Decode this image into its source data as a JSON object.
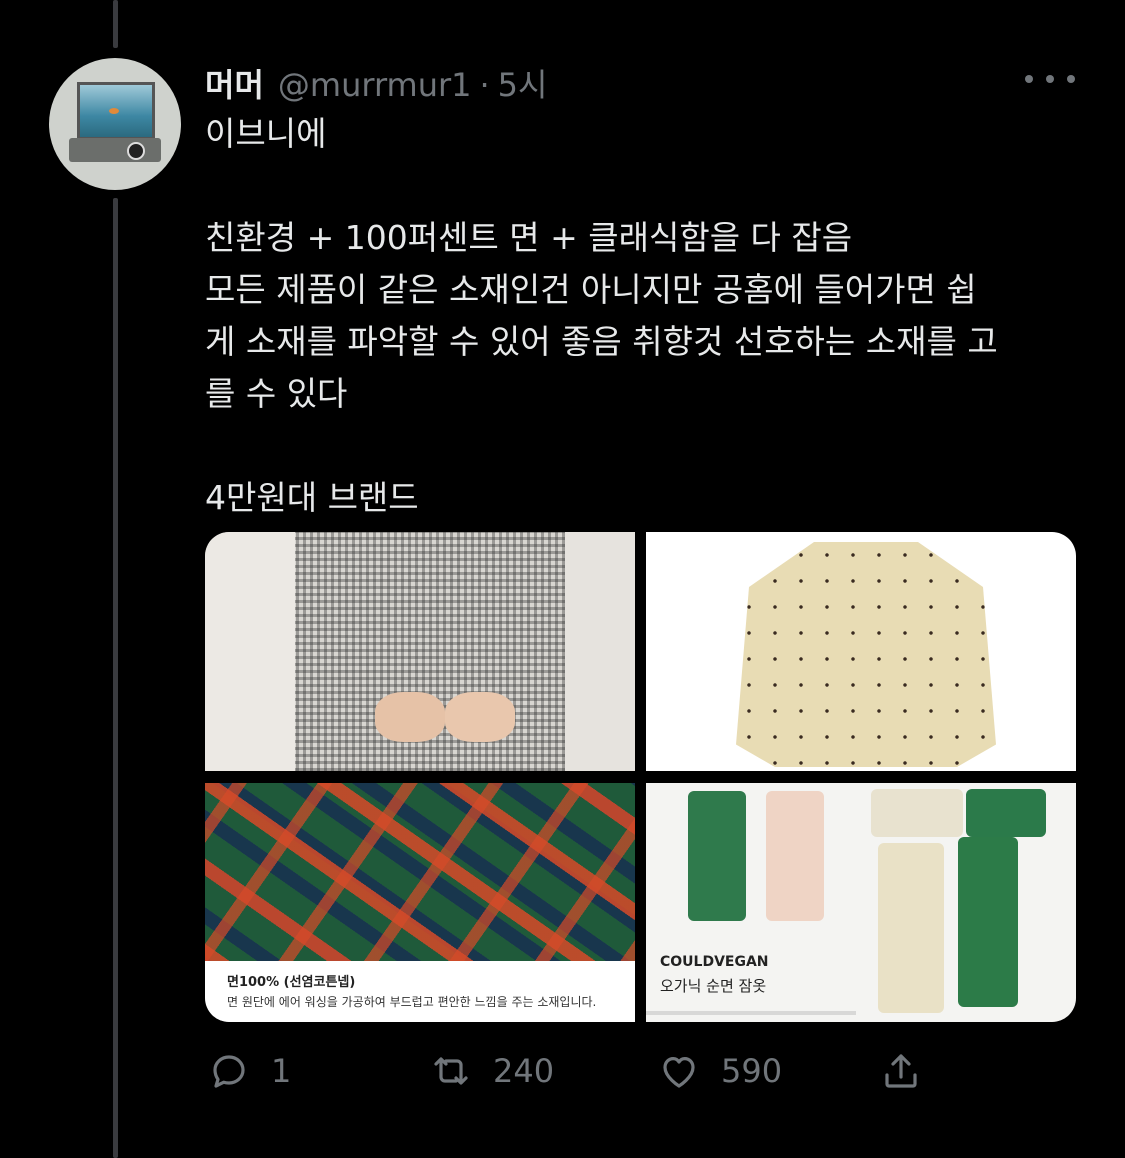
{
  "tweet": {
    "display_name": "머머",
    "handle": "@murrmur1",
    "separator": "·",
    "time": "5시",
    "lines": [
      "이브니에",
      "",
      "친환경 + 100퍼센트 면 + 클래식함을 다 잡음",
      "모든 제품이 같은 소재인건 아니지만 공홈에 들어가면 쉽",
      "게 소재를 파악할 수 있어 좋음 취향것 선호하는 소재를 고",
      "를 수 있다",
      "",
      "4만원대 브랜드"
    ]
  },
  "media": {
    "photo3_caption_title": "면100% (선염코튼넵)",
    "photo3_caption_text": "면 원단에 에어 워싱을 가공하여 부드럽고 편안한 느낌을 주는 소재입니다.",
    "photo4_brand": "COULDVEGAN",
    "photo4_subtitle": "오가닉 순면 잠옷"
  },
  "actions": {
    "reply_count": "1",
    "retweet_count": "240",
    "like_count": "590"
  },
  "icons": [
    "more-icon",
    "reply-icon",
    "retweet-icon",
    "like-icon",
    "share-icon"
  ],
  "colors": {
    "background": "#000000",
    "text": "#e7e9ea",
    "muted": "#71767b",
    "thread_line": "#3a3b3f"
  }
}
